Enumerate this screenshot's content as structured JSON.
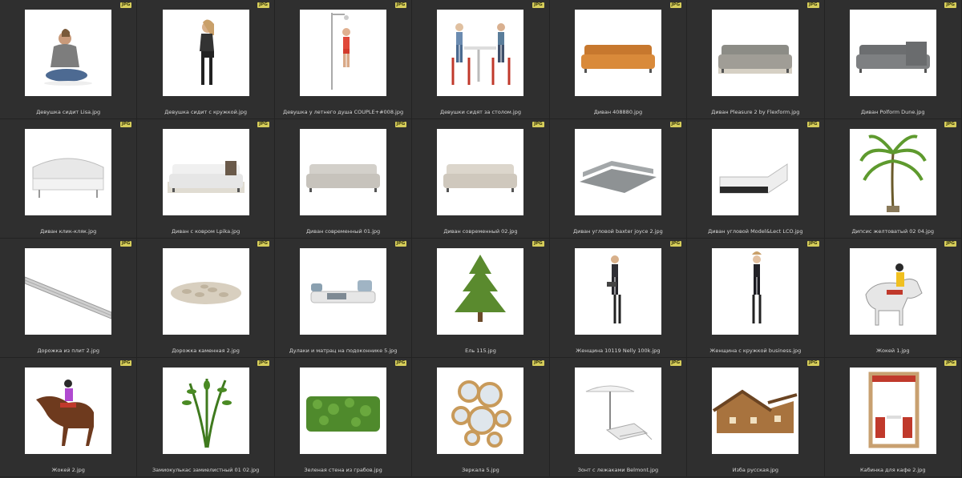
{
  "items": [
    {
      "label": "Девушка сидит Lisa.jpg",
      "badge": "JPG",
      "icon": "woman-sitting"
    },
    {
      "label": "Девушка сидит с кружкой.jpg",
      "badge": "JPG",
      "icon": "woman-sitting-mug"
    },
    {
      "label": "Девушка у летнего душа COUPLE+#008.jpg",
      "badge": "JPG",
      "icon": "woman-shower"
    },
    {
      "label": "Девушки сидят за столом.jpg",
      "badge": "JPG",
      "icon": "women-table"
    },
    {
      "label": "Диван 408880.jpg",
      "badge": "JPG",
      "icon": "sofa-orange"
    },
    {
      "label": "Диван Pleasure 2 by Flexform.jpg",
      "badge": "JPG",
      "icon": "sofa-grey"
    },
    {
      "label": "Диван Polform Dune.jpg",
      "badge": "JPG",
      "icon": "sofa-grey-corner"
    },
    {
      "label": "Диван клик-кляк.jpg",
      "badge": "JPG",
      "icon": "sofa-white-curved"
    },
    {
      "label": "Диван с ковром Lpika.jpg",
      "badge": "JPG",
      "icon": "sofa-white-rug"
    },
    {
      "label": "Диван современный 01.jpg",
      "badge": "JPG",
      "icon": "sofa-beige"
    },
    {
      "label": "Диван современный 02.jpg",
      "badge": "JPG",
      "icon": "sofa-beige-2"
    },
    {
      "label": "Диван угловой baxter joyce 2.jpg",
      "badge": "JPG",
      "icon": "sofa-corner-big"
    },
    {
      "label": "Диван угловой Model&Lect LCO.jpg",
      "badge": "JPG",
      "icon": "sofa-corner-white"
    },
    {
      "label": "Дипсис желтоватый 02 04.jpg",
      "badge": "JPG",
      "icon": "palm"
    },
    {
      "label": "Дорожка из плит 2.jpg",
      "badge": "JPG",
      "icon": "path-slabs"
    },
    {
      "label": "Дорожка каменная 2.jpg",
      "badge": "JPG",
      "icon": "path-stones"
    },
    {
      "label": "Дулаки и матрац на подоконнике 5.jpg",
      "badge": "JPG",
      "icon": "mattress"
    },
    {
      "label": "Ель 115.jpg",
      "badge": "JPG",
      "icon": "fir-tree"
    },
    {
      "label": "Женщина 10119 Nelly 100k.jpg",
      "badge": "JPG",
      "icon": "woman-tablet"
    },
    {
      "label": "Женщина с кружкой business.jpg",
      "badge": "JPG",
      "icon": "woman-business"
    },
    {
      "label": "Жокей 1.jpg",
      "badge": "JPG",
      "icon": "jockey-white-horse"
    },
    {
      "label": "Жокей 2.jpg",
      "badge": "JPG",
      "icon": "jockey-brown-horse"
    },
    {
      "label": "Замиокулькас замиелистный 01 02.jpg",
      "badge": "JPG",
      "icon": "zamioculcas"
    },
    {
      "label": "Зеленая стена из грабов.jpg",
      "badge": "JPG",
      "icon": "green-hedge"
    },
    {
      "label": "Зеркала 5.jpg",
      "badge": "JPG",
      "icon": "mirrors"
    },
    {
      "label": "Зонт с лежаками Belmont.jpg",
      "badge": "JPG",
      "icon": "umbrella-loungers"
    },
    {
      "label": "Изба русская.jpg",
      "badge": "JPG",
      "icon": "log-house"
    },
    {
      "label": "Кабинка для кафе 2.jpg",
      "badge": "JPG",
      "icon": "cafe-booth"
    }
  ]
}
